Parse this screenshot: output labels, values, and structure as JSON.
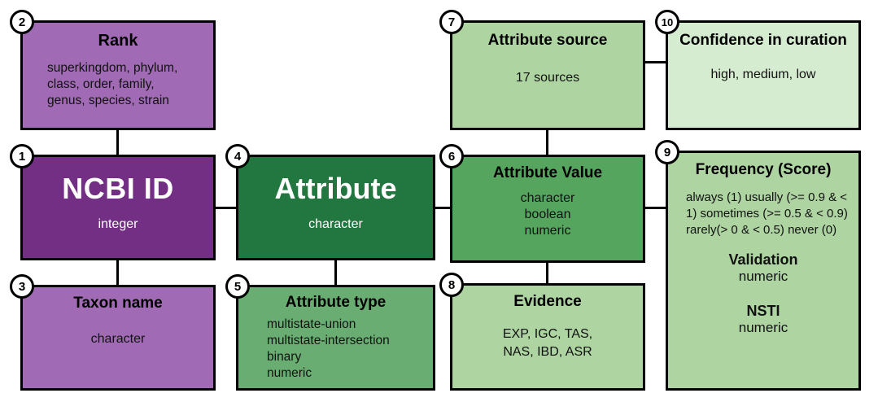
{
  "diagram": {
    "title": "Database schema entity diagram",
    "colors": {
      "dark_purple": "#722f84",
      "light_purple": "#a06bb4",
      "dark_green": "#22763f",
      "medium_green": "#56a55f",
      "green": "#6aad72",
      "light_green": "#aed4a2",
      "pale_green": "#d6ecd0",
      "outline": "#000000"
    },
    "nodes": [
      {
        "id": "1",
        "badge": "1",
        "name": "ncbi-id",
        "title": "NCBI ID",
        "lines": [
          "integer"
        ],
        "fill": "#722f84"
      },
      {
        "id": "2",
        "badge": "2",
        "name": "rank",
        "title": "Rank",
        "lines": [
          "superkingdom, phylum,",
          "class, order, family,",
          "genus, species, strain"
        ],
        "fill": "#a06bb4"
      },
      {
        "id": "3",
        "badge": "3",
        "name": "taxon-name",
        "title": "Taxon name",
        "lines": [
          "character"
        ],
        "fill": "#a06bb4"
      },
      {
        "id": "4",
        "badge": "4",
        "name": "attribute",
        "title": "Attribute",
        "lines": [
          "character"
        ],
        "fill": "#22763f"
      },
      {
        "id": "5",
        "badge": "5",
        "name": "attribute-type",
        "title": "Attribute type",
        "lines": [
          "multistate-union",
          "multistate-intersection",
          "binary",
          "numeric"
        ],
        "fill": "#6aad72"
      },
      {
        "id": "6",
        "badge": "6",
        "name": "attribute-value",
        "title": "Attribute Value",
        "lines": [
          "character",
          "boolean",
          "numeric"
        ],
        "fill": "#56a55f"
      },
      {
        "id": "7",
        "badge": "7",
        "name": "attribute-source",
        "title": "Attribute source",
        "lines": [
          "17 sources"
        ],
        "fill": "#aed4a2"
      },
      {
        "id": "8",
        "badge": "8",
        "name": "evidence",
        "title": "Evidence",
        "lines": [
          "EXP, IGC, TAS,",
          "NAS, IBD, ASR"
        ],
        "fill": "#aed4a2"
      },
      {
        "id": "9",
        "badge": "9",
        "name": "frequency-score",
        "title": "Frequency (Score)",
        "lines": [
          "always (1)",
          "usually (>= 0.9 & < 1)",
          "sometimes (>= 0.5 & < 0.9)",
          "rarely(> 0 & < 0.5)",
          "never (0)"
        ],
        "sub_sections": [
          {
            "heading": "Validation",
            "value": "numeric"
          },
          {
            "heading": "NSTI",
            "value": "numeric"
          }
        ],
        "fill": "#aed4a2"
      },
      {
        "id": "10",
        "badge": "10",
        "name": "confidence-in-curation",
        "title": "Confidence in curation",
        "lines": [
          "high, medium, low"
        ],
        "fill": "#d6ecd0"
      }
    ],
    "connections": [
      {
        "from": "2",
        "to": "1"
      },
      {
        "from": "1",
        "to": "3"
      },
      {
        "from": "1",
        "to": "4"
      },
      {
        "from": "4",
        "to": "5"
      },
      {
        "from": "4",
        "to": "6"
      },
      {
        "from": "6",
        "to": "7"
      },
      {
        "from": "6",
        "to": "8"
      },
      {
        "from": "6",
        "to": "9"
      },
      {
        "from": "7",
        "to": "10"
      }
    ]
  }
}
